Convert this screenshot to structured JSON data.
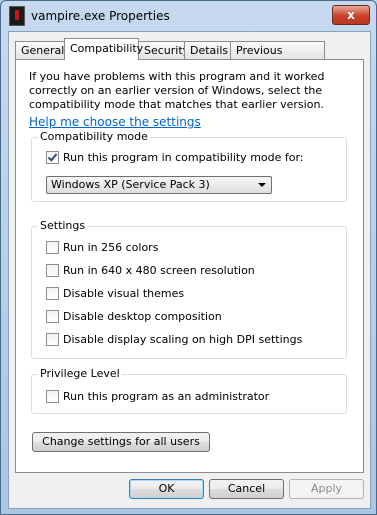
{
  "window": {
    "title": "vampire.exe Properties",
    "close_glyph": "x",
    "icon": "app-icon"
  },
  "tabs": [
    {
      "label": "General",
      "active": false
    },
    {
      "label": "Compatibility",
      "active": true
    },
    {
      "label": "Security",
      "active": false
    },
    {
      "label": "Details",
      "active": false
    },
    {
      "label": "Previous Versions",
      "active": false
    }
  ],
  "intro_text": "If you have problems with this program and it worked correctly on an earlier version of Windows, select the compatibility mode that matches that earlier version.",
  "help_link": "Help me choose the settings",
  "compat_mode": {
    "label": "Compatibility mode",
    "checkbox_label": "Run this program in compatibility mode for:",
    "checked": true,
    "selected_os": "Windows XP (Service Pack 3)"
  },
  "settings": {
    "label": "Settings",
    "options": [
      {
        "label": "Run in 256 colors",
        "checked": false
      },
      {
        "label": "Run in 640 x 480 screen resolution",
        "checked": false
      },
      {
        "label": "Disable visual themes",
        "checked": false
      },
      {
        "label": "Disable desktop composition",
        "checked": false
      },
      {
        "label": "Disable display scaling on high DPI settings",
        "checked": false
      }
    ]
  },
  "privilege": {
    "label": "Privilege Level",
    "checkbox_label": "Run this program as an administrator",
    "checked": false
  },
  "all_users_button": "Change settings for all users",
  "footer": {
    "ok": "OK",
    "cancel": "Cancel",
    "apply": "Apply"
  },
  "colors": {
    "link": "#0066cc",
    "close_button": "#c7422a",
    "titlebar": "#b9d1ea"
  }
}
